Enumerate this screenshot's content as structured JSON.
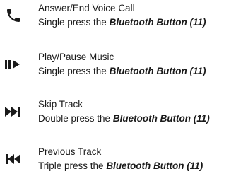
{
  "actions": [
    {
      "title": "Answer/End Voice Call",
      "instruction_prefix": "Single press the",
      "button_ref": "Bluetooth Button (11)",
      "icon": "phone-icon"
    },
    {
      "title": "Play/Pause Music",
      "instruction_prefix": "Single press the",
      "button_ref": "Bluetooth Button (11)",
      "icon": "play-pause-icon"
    },
    {
      "title": "Skip Track",
      "instruction_prefix": "Double press the",
      "button_ref": "Bluetooth Button (11)",
      "icon": "skip-forward-icon"
    },
    {
      "title": "Previous Track",
      "instruction_prefix": "Triple press the",
      "button_ref": "Bluetooth Button (11)",
      "icon": "skip-back-icon"
    }
  ],
  "colors": {
    "text": "#1a1a1a",
    "icon": "#1a1a1a",
    "background": "#ffffff"
  }
}
